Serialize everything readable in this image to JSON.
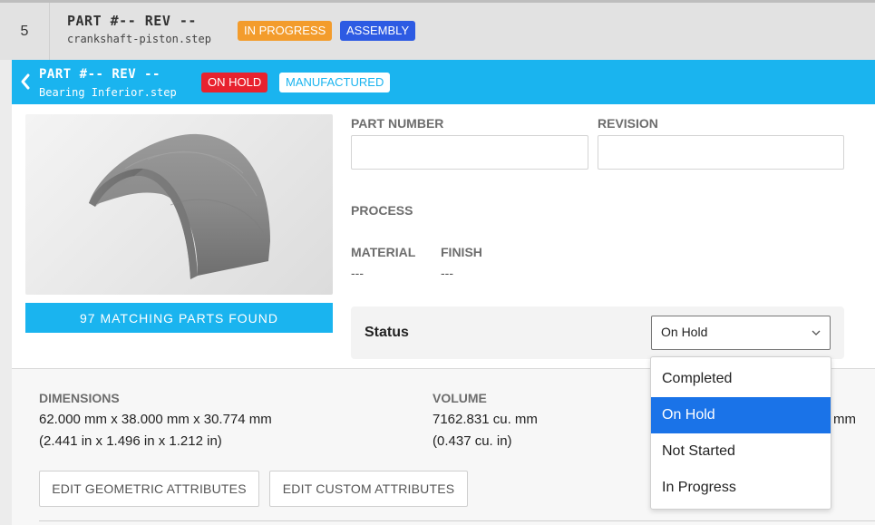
{
  "parent": {
    "index": "5",
    "title": "PART #--  REV --",
    "file": "crankshaft-piston.step",
    "status_badge": "IN PROGRESS",
    "type_badge": "ASSEMBLY"
  },
  "header": {
    "title": "PART #--  REV --",
    "file": "Bearing Inferior.step",
    "status_badge": "ON HOLD",
    "type_badge": "MANUFACTURED"
  },
  "preview": {
    "matching_label": "97 MATCHING PARTS FOUND"
  },
  "form": {
    "part_number_label": "PART NUMBER",
    "part_number_value": "",
    "revision_label": "REVISION",
    "revision_value": "",
    "process_label": "PROCESS",
    "material_label": "MATERIAL",
    "material_value": "---",
    "finish_label": "FINISH",
    "finish_value": "---"
  },
  "status": {
    "label": "Status",
    "selected": "On Hold",
    "options": [
      "Completed",
      "On Hold",
      "Not Started",
      "In Progress"
    ]
  },
  "attributes": {
    "dimensions_label": "DIMENSIONS",
    "dimensions_mm": "62.000 mm x 38.000 mm x 30.774 mm",
    "dimensions_in": "(2.441 in x 1.496 in x 1.212 in)",
    "volume_label": "VOLUME",
    "volume_mm": "7162.831 cu. mm",
    "volume_in": "(0.437 cu. in)",
    "clipped_value": "mm"
  },
  "buttons": {
    "edit_geometric": "EDIT GEOMETRIC ATTRIBUTES",
    "edit_custom": "EDIT CUSTOM ATTRIBUTES"
  },
  "colors": {
    "accent": "#1ab4ef",
    "in_progress": "#f39c2c",
    "assembly": "#2d5be3",
    "on_hold": "#e8222e",
    "dropdown_selected": "#1a73e8"
  }
}
